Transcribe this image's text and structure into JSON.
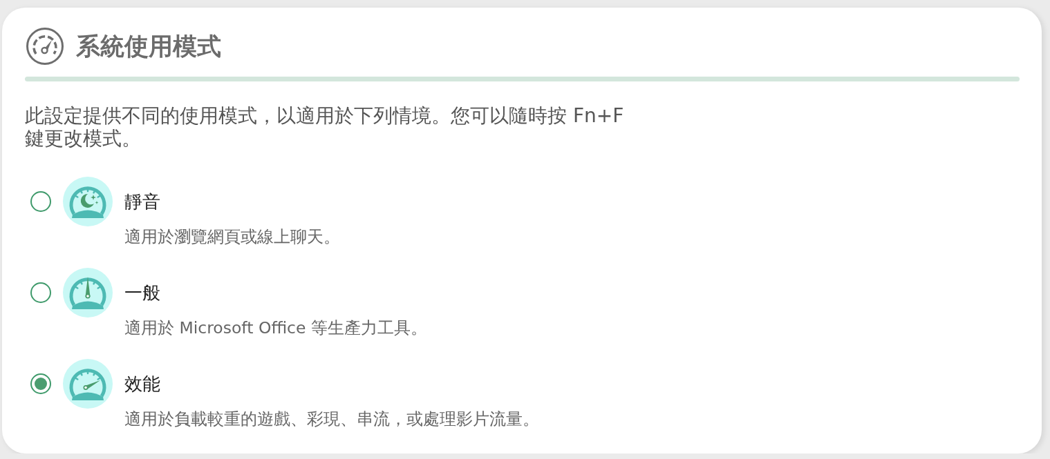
{
  "header": {
    "title": "系統使用模式"
  },
  "description": "此設定提供不同的使用模式，以適用於下列情境。您可以隨時按 Fn+F 鍵更改模式。",
  "modes": [
    {
      "kind": "quiet",
      "name": "靜音",
      "description": "適用於瀏覽網頁或線上聊天。",
      "selected": false
    },
    {
      "kind": "standard",
      "name": "一般",
      "description": "適用於 Microsoft Office 等生產力工具。",
      "selected": false
    },
    {
      "kind": "performance",
      "name": "效能",
      "description": "適用於負載較重的遊戲、彩現、串流，或處理影片流量。",
      "selected": true
    }
  ]
}
